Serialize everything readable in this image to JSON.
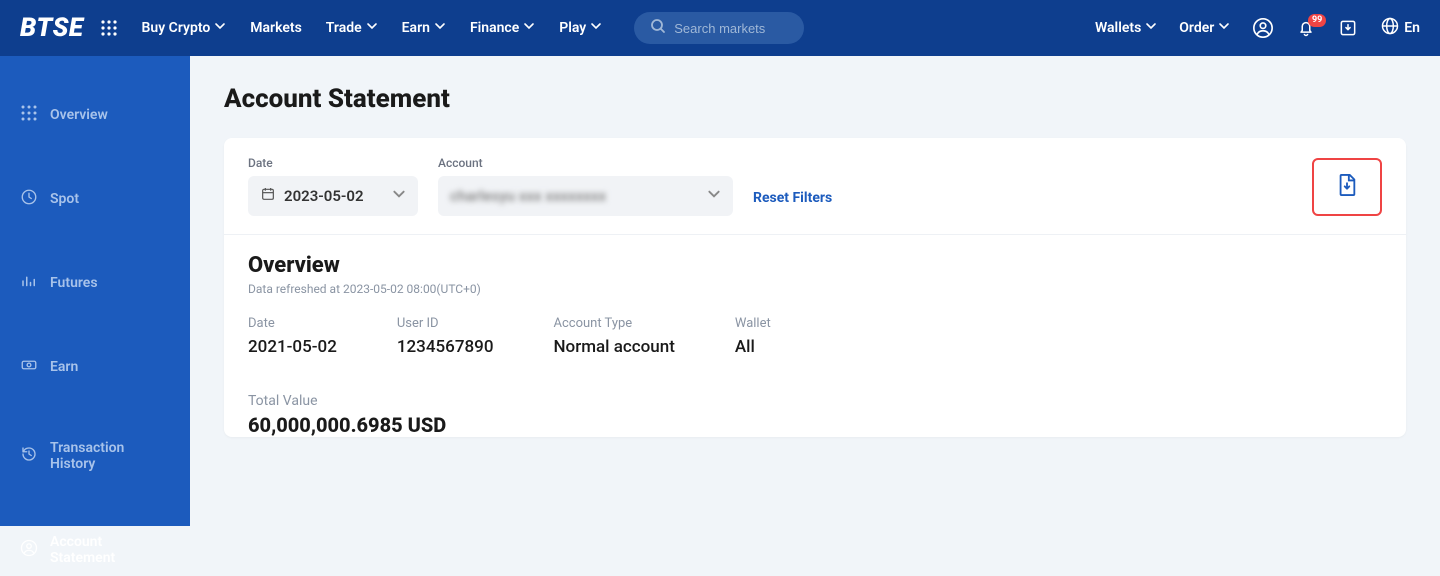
{
  "header": {
    "logo": "BTSE",
    "nav": [
      "Buy Crypto",
      "Markets",
      "Trade",
      "Earn",
      "Finance",
      "Play"
    ],
    "nav_has_dropdown": [
      true,
      false,
      true,
      true,
      true,
      true
    ],
    "search_placeholder": "Search markets",
    "wallets": "Wallets",
    "order": "Order",
    "notif_badge": "99",
    "lang": "En"
  },
  "sidebar": {
    "items": [
      "Overview",
      "Spot",
      "Futures",
      "Earn",
      "Transaction History",
      "Account Statement"
    ],
    "active_index": 5
  },
  "page": {
    "title": "Account Statement"
  },
  "filters": {
    "date_label": "Date",
    "date_value": "2023-05-02",
    "account_label": "Account",
    "account_value": "charlesyu  xxx xxxxxxxx",
    "reset": "Reset Filters"
  },
  "overview": {
    "title": "Overview",
    "refreshed": "Data refreshed at 2023-05-02 08:00(UTC+0)",
    "cells": [
      {
        "label": "Date",
        "value": "2021-05-02"
      },
      {
        "label": "User ID",
        "value": "1234567890"
      },
      {
        "label": "Account Type",
        "value": "Normal account"
      },
      {
        "label": "Wallet",
        "value": "All"
      }
    ],
    "total_label": "Total Value",
    "total_value": "60,000,000.6985 USD"
  }
}
